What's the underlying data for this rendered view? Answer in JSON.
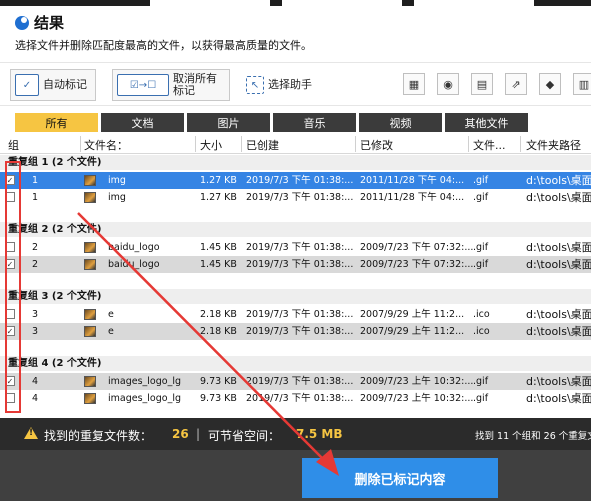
{
  "header": {
    "title": "结果",
    "subtitle": "选择文件并删除匹配度最高的文件，以获得最高质量的文件。"
  },
  "toolbar": {
    "auto_mark": "自动标记",
    "unmark_all": "取消所有标记",
    "selection_assistant": "选择助手",
    "icons": [
      "grid-icon",
      "location-pin-icon",
      "save-doc-icon",
      "external-link-icon",
      "eraser-icon",
      "document-icon"
    ]
  },
  "tabs": [
    "所有",
    "文档",
    "图片",
    "音乐",
    "视频",
    "其他文件"
  ],
  "active_tab": 0,
  "columns": [
    "组",
    "文件名：",
    "大小",
    "已创建",
    "已修改",
    "文件...",
    "文件夹路径"
  ],
  "groups": [
    {
      "label": "重复组 1 (2 个文件)",
      "rows": [
        {
          "checked": true,
          "style": "sel",
          "group": "1",
          "name": "img",
          "size": "1.27 KB",
          "created": "2019/7/3 下午 01:38:...",
          "modified": "2011/11/28 下午 04:...",
          "ext": ".gif",
          "path": "d:\\tools\\桌面"
        },
        {
          "checked": false,
          "style": "",
          "group": "1",
          "name": "img",
          "size": "1.27 KB",
          "created": "2019/7/3 下午 01:38:...",
          "modified": "2011/11/28 下午 04:...",
          "ext": ".gif",
          "path": "d:\\tools\\桌面"
        }
      ]
    },
    {
      "label": "重复组 2 (2 个文件)",
      "rows": [
        {
          "checked": false,
          "style": "",
          "group": "2",
          "name": "baidu_logo",
          "size": "1.45 KB",
          "created": "2019/7/3 下午 01:38:...",
          "modified": "2009/7/23 下午 07:32:...",
          "ext": ".gif",
          "path": "d:\\tools\\桌面\\"
        },
        {
          "checked": true,
          "style": "alt",
          "group": "2",
          "name": "baidu_logo",
          "size": "1.45 KB",
          "created": "2019/7/3 下午 01:38:...",
          "modified": "2009/7/23 下午 07:32:...",
          "ext": ".gif",
          "path": "d:\\tools\\桌面\\"
        }
      ]
    },
    {
      "label": "重复组 3 (2 个文件)",
      "rows": [
        {
          "checked": false,
          "style": "",
          "group": "3",
          "name": "e",
          "size": "2.18 KB",
          "created": "2019/7/3 下午 01:38:...",
          "modified": "2007/9/29 上午 11:2...",
          "ext": ".ico",
          "path": "d:\\tools\\桌面\\"
        },
        {
          "checked": true,
          "style": "alt",
          "group": "3",
          "name": "e",
          "size": "2.18 KB",
          "created": "2019/7/3 下午 01:38:...",
          "modified": "2007/9/29 上午 11:2...",
          "ext": ".ico",
          "path": "d:\\tools\\桌面\\"
        }
      ]
    },
    {
      "label": "重复组 4 (2 个文件)",
      "rows": [
        {
          "checked": true,
          "style": "alt",
          "group": "4",
          "name": "images_logo_lg",
          "size": "9.73 KB",
          "created": "2019/7/3 下午 01:38:...",
          "modified": "2009/7/23 上午 10:32:...",
          "ext": ".gif",
          "path": "d:\\tools\\桌面\\"
        },
        {
          "checked": false,
          "style": "",
          "group": "4",
          "name": "images_logo_lg",
          "size": "9.73 KB",
          "created": "2019/7/3 下午 01:38:...",
          "modified": "2009/7/23 上午 10:32:...",
          "ext": ".gif",
          "path": "d:\\tools\\桌面\\"
        }
      ]
    }
  ],
  "footer": {
    "found_label": "找到的重复文件数：",
    "found_count": "26",
    "separator": "|",
    "space_label": "可节省空间：",
    "space_value": "7.5 MB",
    "summary": "找到 11 个组和 26 个重复文"
  },
  "delete_button": "删除已标记内容",
  "colors": {
    "accent": "#3584e4",
    "tab_active": "#f6c542",
    "annotation": "#e53935",
    "button": "#2f8ee8"
  }
}
